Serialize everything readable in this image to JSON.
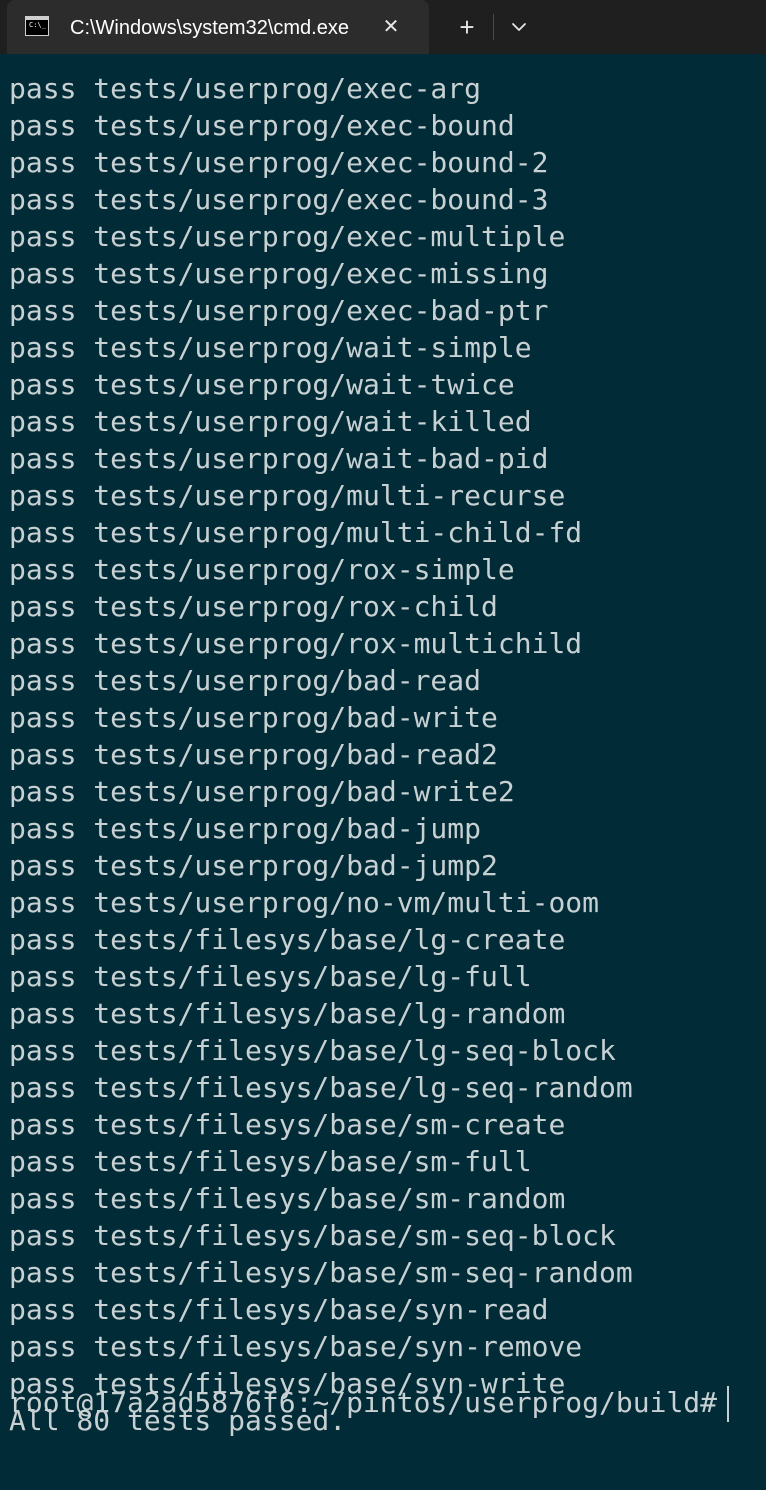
{
  "window": {
    "tab_title": "C:\\Windows\\system32\\cmd.exe",
    "tab_icon_text": "C:\\_",
    "close_glyph": "✕",
    "new_tab_glyph": "+",
    "icons": [
      "cmd-icon",
      "close-icon",
      "plus-icon",
      "chevron-down-icon"
    ]
  },
  "colors": {
    "terminal_bg": "#012b36",
    "terminal_fg": "#c7d0d2",
    "titlebar_bg": "#1f1f1f",
    "tab_bg": "#2c2c2c"
  },
  "terminal": {
    "lines": [
      "pass tests/userprog/exec-arg",
      "pass tests/userprog/exec-bound",
      "pass tests/userprog/exec-bound-2",
      "pass tests/userprog/exec-bound-3",
      "pass tests/userprog/exec-multiple",
      "pass tests/userprog/exec-missing",
      "pass tests/userprog/exec-bad-ptr",
      "pass tests/userprog/wait-simple",
      "pass tests/userprog/wait-twice",
      "pass tests/userprog/wait-killed",
      "pass tests/userprog/wait-bad-pid",
      "pass tests/userprog/multi-recurse",
      "pass tests/userprog/multi-child-fd",
      "pass tests/userprog/rox-simple",
      "pass tests/userprog/rox-child",
      "pass tests/userprog/rox-multichild",
      "pass tests/userprog/bad-read",
      "pass tests/userprog/bad-write",
      "pass tests/userprog/bad-read2",
      "pass tests/userprog/bad-write2",
      "pass tests/userprog/bad-jump",
      "pass tests/userprog/bad-jump2",
      "pass tests/userprog/no-vm/multi-oom",
      "pass tests/filesys/base/lg-create",
      "pass tests/filesys/base/lg-full",
      "pass tests/filesys/base/lg-random",
      "pass tests/filesys/base/lg-seq-block",
      "pass tests/filesys/base/lg-seq-random",
      "pass tests/filesys/base/sm-create",
      "pass tests/filesys/base/sm-full",
      "pass tests/filesys/base/sm-random",
      "pass tests/filesys/base/sm-seq-block",
      "pass tests/filesys/base/sm-seq-random",
      "pass tests/filesys/base/syn-read",
      "pass tests/filesys/base/syn-remove",
      "pass tests/filesys/base/syn-write",
      "All 80 tests passed."
    ],
    "prompt": "root@17a2ad5876f6:~/pintos/userprog/build#"
  }
}
